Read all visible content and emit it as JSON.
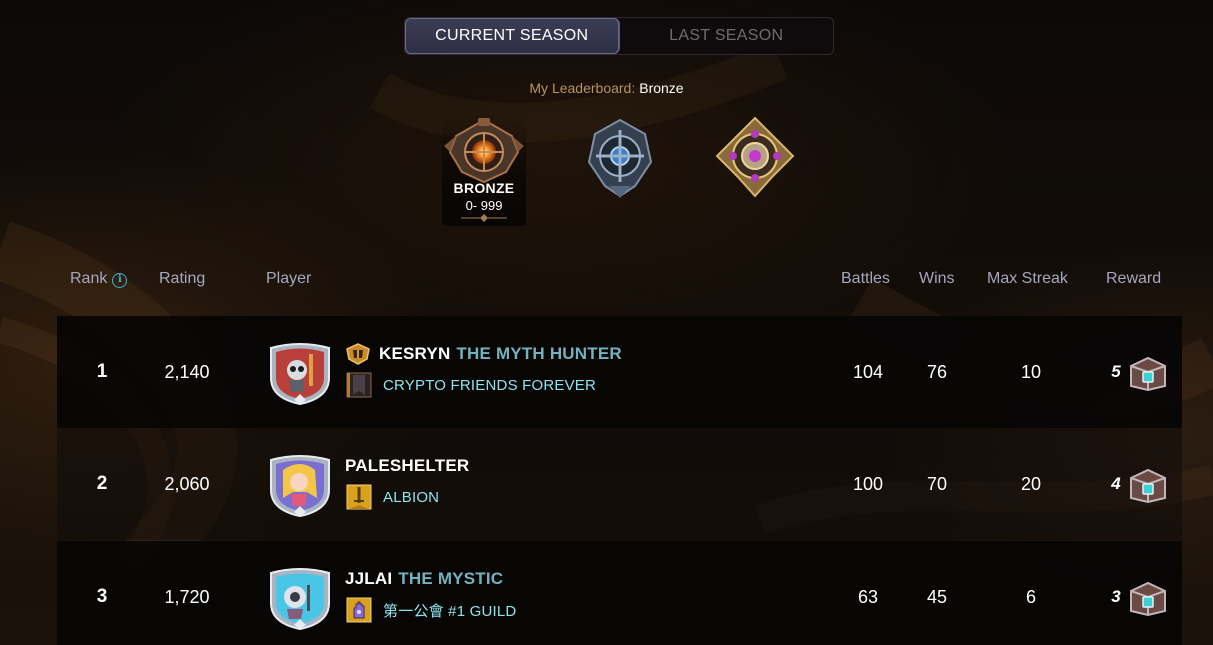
{
  "season_toggle": {
    "current_label": "CURRENT SEASON",
    "last_label": "LAST SEASON"
  },
  "my_leaderboard": {
    "label": "My Leaderboard:",
    "value": "Bronze"
  },
  "leagues": [
    {
      "icon": "bronze-league-icon",
      "name": "BRONZE",
      "range": "0- 999",
      "selected": true
    },
    {
      "icon": "silver-league-icon",
      "name": "",
      "range": "",
      "selected": false
    },
    {
      "icon": "gold-league-icon",
      "name": "",
      "range": "",
      "selected": false
    }
  ],
  "columns": {
    "rank": "Rank",
    "rating": "Rating",
    "player": "Player",
    "battles": "Battles",
    "wins": "Wins",
    "max_streak": "Max Streak",
    "reward": "Reward"
  },
  "rows": [
    {
      "rank": "1",
      "rating": "2,140",
      "name": "KESRYN",
      "title": "THE MYTH HUNTER",
      "guild": "CRYPTO FRIENDS FOREVER",
      "battles": "104",
      "wins": "76",
      "max_streak": "10",
      "reward_count": "5",
      "avatar_icon": "skeleton-warrior-avatar-icon",
      "guild_icon": "dark-banner-icon"
    },
    {
      "rank": "2",
      "rating": "2,060",
      "name": "PALESHELTER",
      "title": "",
      "guild": "ALBION",
      "battles": "100",
      "wins": "70",
      "max_streak": "20",
      "reward_count": "4",
      "avatar_icon": "blonde-mage-avatar-icon",
      "guild_icon": "sword-banner-icon"
    },
    {
      "rank": "3",
      "rating": "1,720",
      "name": "JJLAI",
      "title": "THE MYSTIC",
      "guild": "第一公會 #1 GUILD",
      "battles": "63",
      "wins": "45",
      "max_streak": "6",
      "reward_count": "3",
      "avatar_icon": "robot-avatar-icon",
      "guild_icon": "hand-banner-icon"
    }
  ],
  "colors": {
    "title_accent": "#74b2be",
    "guild_text": "#8fe3ea",
    "header_text": "#a7a6c0",
    "label_gold": "#b79363"
  }
}
